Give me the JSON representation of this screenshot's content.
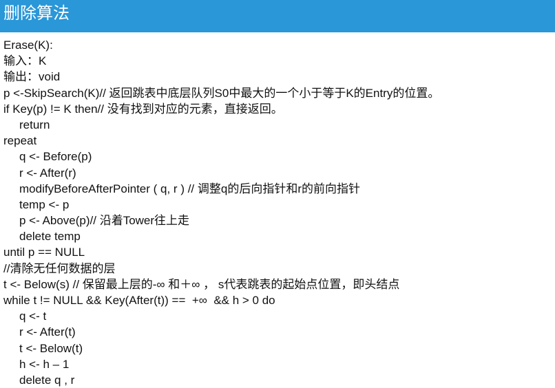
{
  "title": "删除算法",
  "lines": [
    {
      "text": "Erase(K):",
      "indent": false
    },
    {
      "text": "输入：K",
      "indent": false
    },
    {
      "text": "输出：void",
      "indent": false
    },
    {
      "text": "p <-SkipSearch(K)// 返回跳表中底层队列S0中最大的一个小于等于K的Entry的位置。",
      "indent": false
    },
    {
      "text": "if Key(p) != K then// 没有找到对应的元素，直接返回。",
      "indent": false
    },
    {
      "text": "return",
      "indent": true
    },
    {
      "text": "repeat",
      "indent": false
    },
    {
      "text": "q <- Before(p)",
      "indent": true
    },
    {
      "text": "r <- After(r)",
      "indent": true
    },
    {
      "text": "modifyBeforeAfterPointer ( q, r ) // 调整q的后向指针和r的前向指针",
      "indent": true
    },
    {
      "text": "temp <- p",
      "indent": true
    },
    {
      "text": "p <- Above(p)// 沿着Tower往上走",
      "indent": true
    },
    {
      "text": "delete temp",
      "indent": true
    },
    {
      "text": "until p == NULL",
      "indent": false
    },
    {
      "text": "//清除无任何数据的层",
      "indent": false
    },
    {
      "text": "t <- Below(s) // 保留最上层的-∞ 和＋∞ ， s代表跳表的起始点位置，即头结点",
      "indent": false
    },
    {
      "text": "while t != NULL && Key(After(t)) ==  +∞  && h > 0 do",
      "indent": false
    },
    {
      "text": "q <- t",
      "indent": true
    },
    {
      "text": "r <- After(t)",
      "indent": true
    },
    {
      "text": "t <- Below(t)",
      "indent": true
    },
    {
      "text": "h <- h – 1",
      "indent": true
    },
    {
      "text": "delete q , r",
      "indent": true
    }
  ]
}
